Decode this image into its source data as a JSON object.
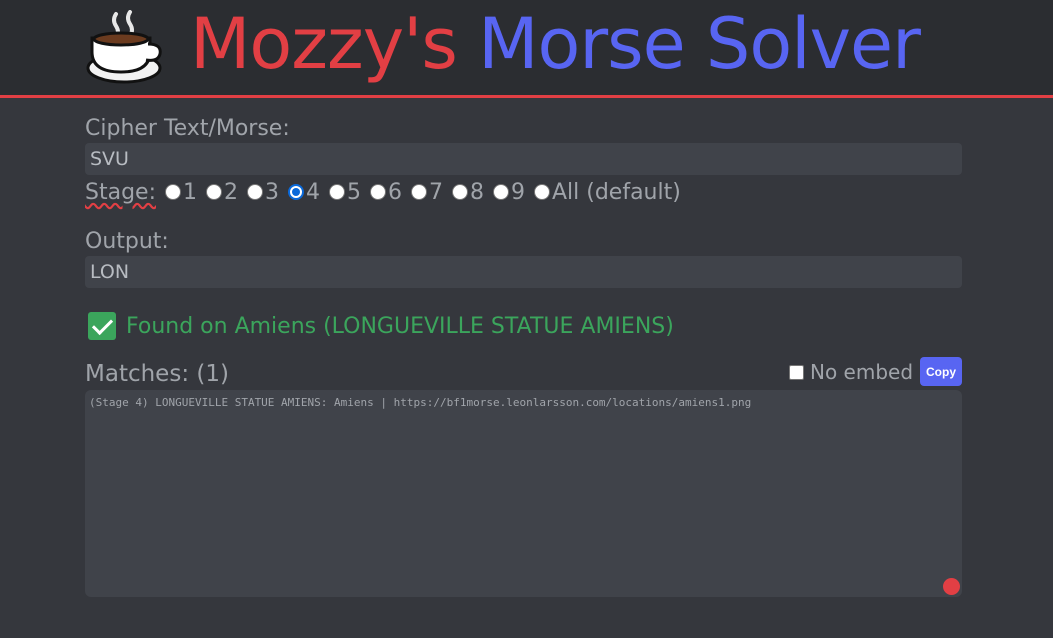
{
  "header": {
    "icon": "coffee-cup-icon",
    "title_part1": "Mozzy's",
    "title_part2": "Morse Solver",
    "colors": {
      "red": "#e23f44",
      "blue": "#5865f2"
    }
  },
  "cipher": {
    "label": "Cipher Text/Morse:",
    "value": "SVU"
  },
  "stage": {
    "label": "Stage:",
    "options": [
      "1",
      "2",
      "3",
      "4",
      "5",
      "6",
      "7",
      "8",
      "9",
      "All (default)"
    ],
    "selected": "4"
  },
  "output": {
    "label": "Output:",
    "value": "LON"
  },
  "found": {
    "icon": "check-mark-icon",
    "text": "Found on Amiens (LONGUEVILLE STATUE AMIENS)"
  },
  "matches": {
    "label": "Matches: (1)",
    "no_embed_label": "No embed",
    "copy_label": "Copy",
    "text": "(Stage 4) LONGUEVILLE STATUE AMIENS: Amiens | https://bf1morse.leonlarsson.com/locations/amiens1.png"
  }
}
